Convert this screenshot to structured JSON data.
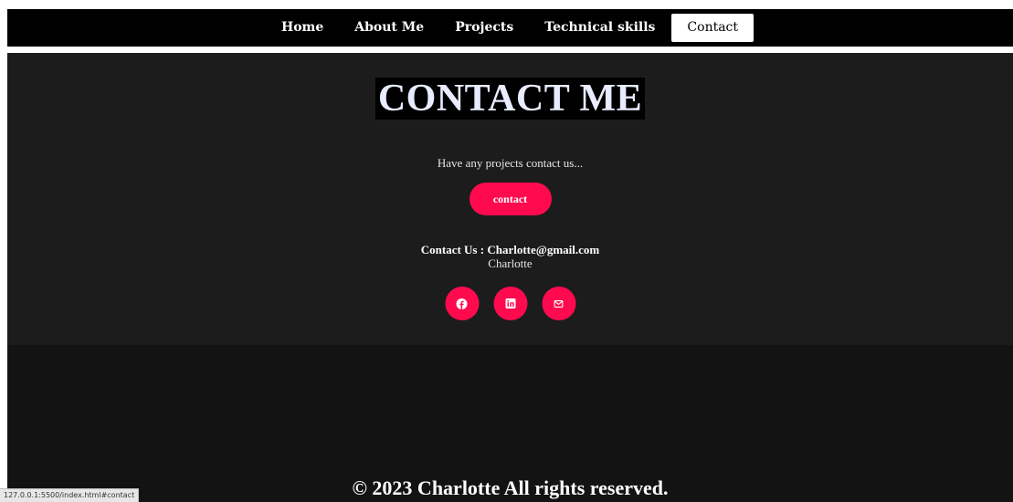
{
  "nav": {
    "items": [
      {
        "label": "Home"
      },
      {
        "label": "About Me"
      },
      {
        "label": "Projects"
      },
      {
        "label": "Technical skills"
      },
      {
        "label": "Contact"
      }
    ],
    "active": "Contact"
  },
  "contact": {
    "title": "CONTACT ME",
    "tagline": "Have any projects contact us...",
    "button_label": "contact",
    "contact_line": "Contact Us : Charlotte@gmail.com",
    "name": "Charlotte",
    "socials": [
      {
        "icon": "facebook-icon"
      },
      {
        "icon": "linkedin-icon"
      },
      {
        "icon": "mail-icon"
      }
    ]
  },
  "footer": {
    "copyright": "© 2023 Charlotte All rights reserved."
  },
  "status_bar": {
    "url": "127.0.0.1:5500/index.html#contact"
  },
  "colors": {
    "accent": "#ff0a4f",
    "nav_bg": "#000000",
    "section_bg": "#1c1c1c",
    "footer_bg": "#131313"
  }
}
